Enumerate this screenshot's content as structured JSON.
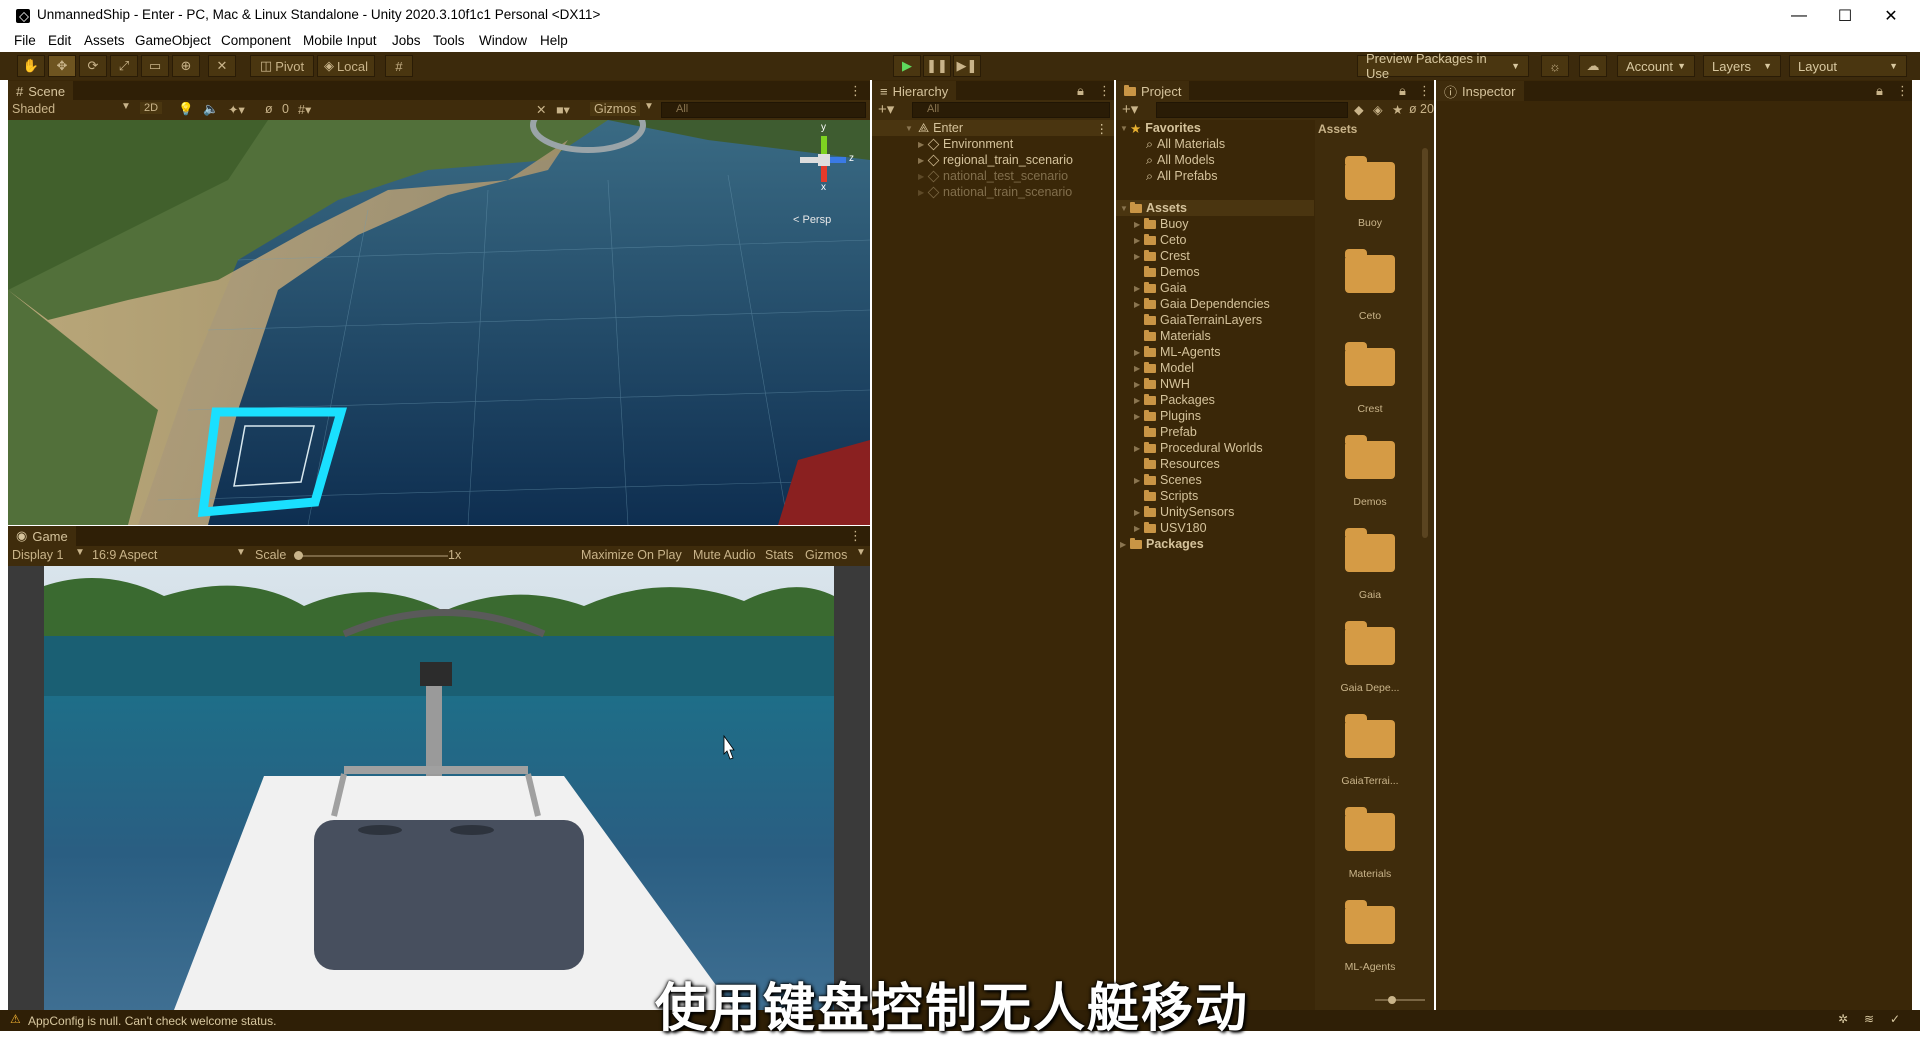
{
  "window": {
    "title": "UnmannedShip - Enter - PC, Mac & Linux Standalone - Unity 2020.3.10f1c1 Personal <DX11>",
    "minimize": "—",
    "maximize": "☐",
    "close": "✕"
  },
  "menu": [
    "File",
    "Edit",
    "Assets",
    "GameObject",
    "Component",
    "Mobile Input",
    "Jobs",
    "Tools",
    "Window",
    "Help"
  ],
  "toolbar": {
    "pivot": "Pivot",
    "local": "Local",
    "preview_packages": "Preview Packages in Use",
    "account": "Account",
    "layers": "Layers",
    "layout": "Layout"
  },
  "scene": {
    "tab": "Scene",
    "shading": "Shaded",
    "mode2d": "2D",
    "gizmos": "Gizmos",
    "search_placeholder": "All",
    "hidden_count": "0",
    "persp": "< Persp",
    "axis_y": "y",
    "axis_z": "z",
    "axis_x": "x"
  },
  "game": {
    "tab": "Game",
    "display": "Display 1",
    "aspect": "16:9 Aspect",
    "scale_label": "Scale",
    "scale_value": "1x",
    "maximize": "Maximize On Play",
    "mute": "Mute Audio",
    "stats": "Stats",
    "gizmos": "Gizmos"
  },
  "hierarchy": {
    "tab": "Hierarchy",
    "search_placeholder": "All",
    "root": "Enter",
    "items": [
      {
        "label": "Environment",
        "disabled": false
      },
      {
        "label": "regional_train_scenario",
        "disabled": false
      },
      {
        "label": "national_test_scenario",
        "disabled": true
      },
      {
        "label": "national_train_scenario",
        "disabled": true
      }
    ]
  },
  "project": {
    "tab": "Project",
    "hidden_count": "20",
    "favorites": "Favorites",
    "favorite_items": [
      "All Materials",
      "All Models",
      "All Prefabs"
    ],
    "assets_label": "Assets",
    "asset_folders": [
      {
        "label": "Buoy",
        "caret": true
      },
      {
        "label": "Ceto",
        "caret": true
      },
      {
        "label": "Crest",
        "caret": true
      },
      {
        "label": "Demos",
        "caret": false
      },
      {
        "label": "Gaia",
        "caret": true
      },
      {
        "label": "Gaia Dependencies",
        "caret": true
      },
      {
        "label": "GaiaTerrainLayers",
        "caret": false
      },
      {
        "label": "Materials",
        "caret": false
      },
      {
        "label": "ML-Agents",
        "caret": true
      },
      {
        "label": "Model",
        "caret": true
      },
      {
        "label": "NWH",
        "caret": true
      },
      {
        "label": "Packages",
        "caret": true
      },
      {
        "label": "Plugins",
        "caret": true
      },
      {
        "label": "Prefab",
        "caret": false
      },
      {
        "label": "Procedural Worlds",
        "caret": true
      },
      {
        "label": "Resources",
        "caret": false
      },
      {
        "label": "Scenes",
        "caret": true
      },
      {
        "label": "Scripts",
        "caret": false
      },
      {
        "label": "UnitySensors",
        "caret": true
      },
      {
        "label": "USV180",
        "caret": true
      }
    ],
    "packages": "Packages",
    "grid_header": "Assets",
    "grid": [
      "Buoy",
      "Ceto",
      "Crest",
      "Demos",
      "Gaia",
      "Gaia Depe...",
      "GaiaTerrai...",
      "Materials",
      "ML-Agents"
    ]
  },
  "inspector": {
    "tab": "Inspector"
  },
  "status": {
    "message": "AppConfig is null. Can't check welcome status."
  },
  "subtitle": "使用键盘控制无人艇移动"
}
